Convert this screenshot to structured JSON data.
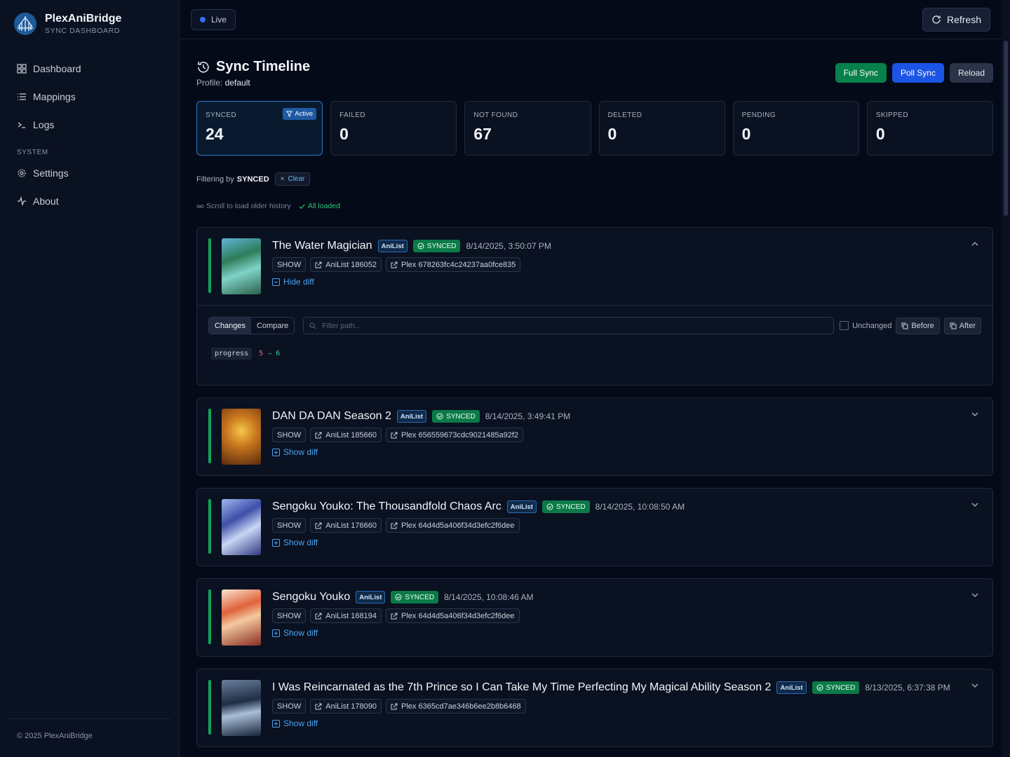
{
  "brand": {
    "name": "PlexAniBridge",
    "subtitle": "SYNC DASHBOARD"
  },
  "nav": {
    "items": [
      {
        "label": "Dashboard",
        "icon": "grid-icon"
      },
      {
        "label": "Mappings",
        "icon": "list-icon"
      },
      {
        "label": "Logs",
        "icon": "terminal-icon"
      }
    ],
    "section": "SYSTEM",
    "system_items": [
      {
        "label": "Settings",
        "icon": "gear-icon"
      },
      {
        "label": "About",
        "icon": "activity-icon"
      }
    ]
  },
  "footer": "© 2025 PlexAniBridge",
  "topbar": {
    "live": "Live",
    "refresh": "Refresh"
  },
  "header": {
    "title": "Sync Timeline",
    "profile_label": "Profile:",
    "profile_value": "default",
    "actions": {
      "full_sync": "Full Sync",
      "poll_sync": "Poll Sync",
      "reload": "Reload"
    }
  },
  "stats": [
    {
      "label": "SYNCED",
      "value": "24",
      "badge": "Active"
    },
    {
      "label": "FAILED",
      "value": "0"
    },
    {
      "label": "NOT FOUND",
      "value": "67"
    },
    {
      "label": "DELETED",
      "value": "0"
    },
    {
      "label": "PENDING",
      "value": "0"
    },
    {
      "label": "SKIPPED",
      "value": "0"
    }
  ],
  "filter": {
    "prefix": "Filtering by",
    "value": "SYNCED",
    "clear": "Clear"
  },
  "hint": {
    "scroll": "Scroll to load older history",
    "loaded": "All loaded"
  },
  "diff": {
    "tab_changes": "Changes",
    "tab_compare": "Compare",
    "filter_placeholder": "Filter path...",
    "unchanged": "Unchanged",
    "before": "Before",
    "after": "After",
    "path": "progress",
    "old": "5",
    "arrow": "→",
    "new": "6"
  },
  "entries": [
    {
      "title": "The Water Magician",
      "source": "AniList",
      "status": "SYNCED",
      "time": "8/14/2025, 3:50:07 PM",
      "type": "SHOW",
      "anilist": "AniList 186052",
      "plex": "Plex 678263fc4c24237aa0fce835",
      "toggle": "Hide diff"
    },
    {
      "title": "DAN DA DAN Season 2",
      "source": "AniList",
      "status": "SYNCED",
      "time": "8/14/2025, 3:49:41 PM",
      "type": "SHOW",
      "anilist": "AniList 185660",
      "plex": "Plex 656559673cdc9021485a92f2",
      "toggle": "Show diff"
    },
    {
      "title": "Sengoku Youko: The Thousandfold Chaos Arc",
      "source": "AniList",
      "status": "SYNCED",
      "time": "8/14/2025, 10:08:50 AM",
      "type": "SHOW",
      "anilist": "AniList 176660",
      "plex": "Plex 64d4d5a406f34d3efc2f6dee",
      "toggle": "Show diff"
    },
    {
      "title": "Sengoku Youko",
      "source": "AniList",
      "status": "SYNCED",
      "time": "8/14/2025, 10:08:46 AM",
      "type": "SHOW",
      "anilist": "AniList 168194",
      "plex": "Plex 64d4d5a406f34d3efc2f6dee",
      "toggle": "Show diff"
    },
    {
      "title": "I Was Reincarnated as the 7th Prince so I Can Take My Time Perfecting My Magical Ability Season 2",
      "source": "AniList",
      "status": "SYNCED",
      "time": "8/13/2025, 6:37:38 PM",
      "type": "SHOW",
      "anilist": "AniList 178090",
      "plex": "Plex 6365cd7ae346b6ee2b8b6468",
      "toggle": "Show diff"
    }
  ],
  "colors": {
    "accent_green": "#12a25b",
    "brand_blue": "#1c55e5",
    "link_blue": "#4aa3f0"
  }
}
